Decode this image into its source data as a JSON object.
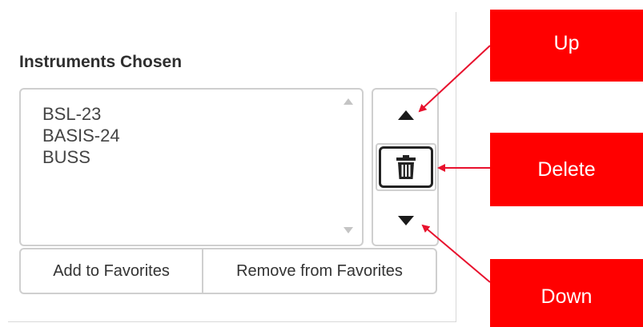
{
  "section": {
    "title": "Instruments Chosen"
  },
  "instruments": [
    {
      "label": "BSL-23"
    },
    {
      "label": "BASIS-24"
    },
    {
      "label": "BUSS"
    }
  ],
  "favorites": {
    "add_label": "Add to Favorites",
    "remove_label": "Remove from Favorites"
  },
  "controls": {
    "up_icon": "caret-up-icon",
    "delete_icon": "trash-icon",
    "down_icon": "caret-down-icon"
  },
  "callouts": {
    "up": "Up",
    "delete": "Delete",
    "down": "Down"
  },
  "colors": {
    "callout_bg": "#ff0000",
    "arrow": "#e8112d"
  }
}
